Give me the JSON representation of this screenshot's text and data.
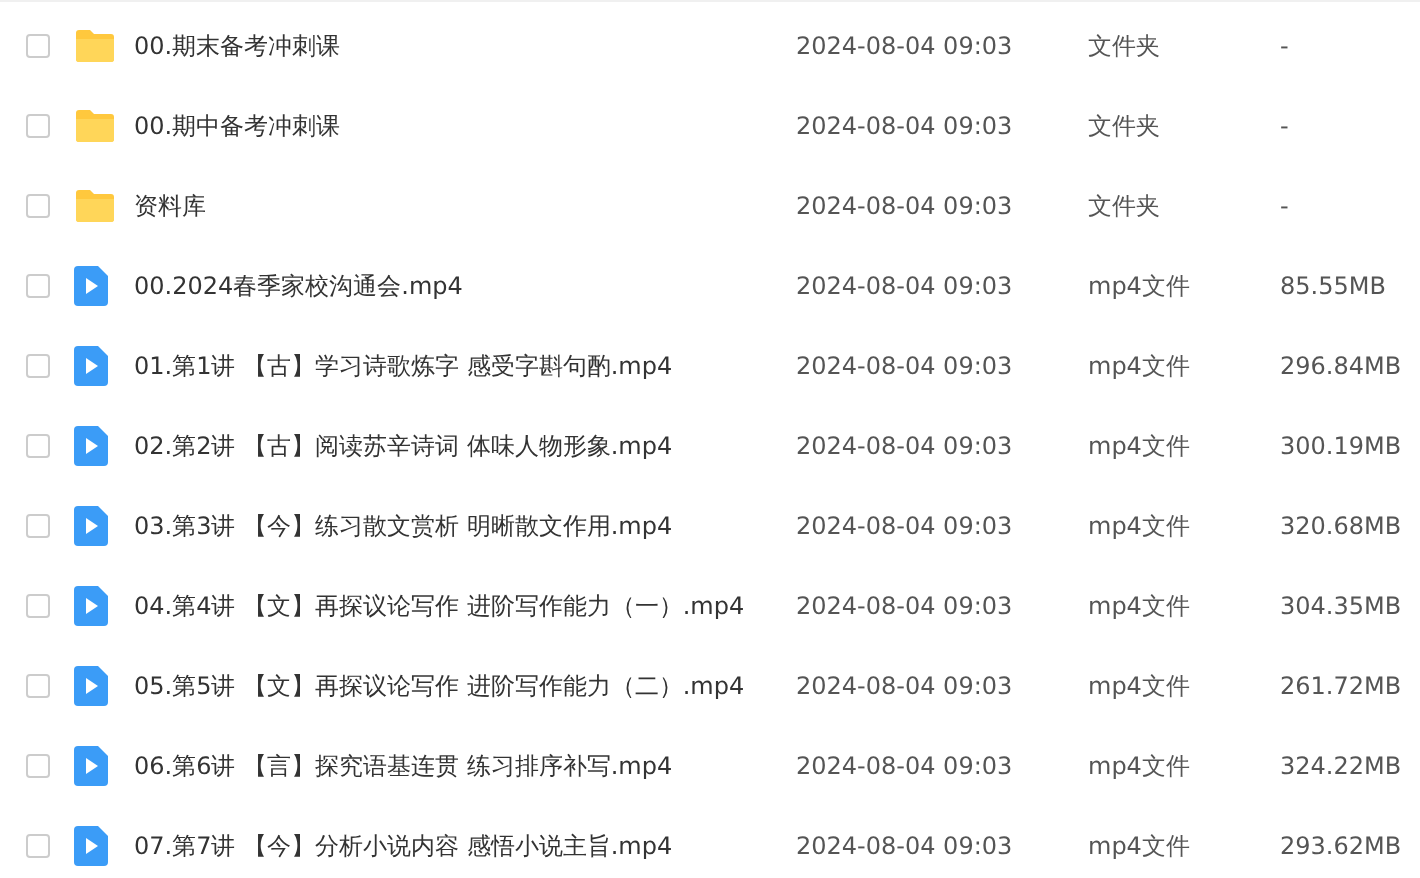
{
  "files": [
    {
      "kind": "folder",
      "checked": false,
      "name": "00.期末备考冲刺课",
      "modified": "2024-08-04 09:03",
      "type": "文件夹",
      "size": "-"
    },
    {
      "kind": "folder",
      "checked": false,
      "name": "00.期中备考冲刺课",
      "modified": "2024-08-04 09:03",
      "type": "文件夹",
      "size": "-"
    },
    {
      "kind": "folder",
      "checked": false,
      "name": "资料库",
      "modified": "2024-08-04 09:03",
      "type": "文件夹",
      "size": "-"
    },
    {
      "kind": "video",
      "checked": false,
      "name": "00.2024春季家校沟通会.mp4",
      "modified": "2024-08-04 09:03",
      "type": "mp4文件",
      "size": "85.55MB"
    },
    {
      "kind": "video",
      "checked": false,
      "name": "01.第1讲 【古】学习诗歌炼字 感受字斟句酌.mp4",
      "modified": "2024-08-04 09:03",
      "type": "mp4文件",
      "size": "296.84MB"
    },
    {
      "kind": "video",
      "checked": false,
      "name": "02.第2讲 【古】阅读苏辛诗词 体味人物形象.mp4",
      "modified": "2024-08-04 09:03",
      "type": "mp4文件",
      "size": "300.19MB"
    },
    {
      "kind": "video",
      "checked": false,
      "name": "03.第3讲 【今】练习散文赏析 明晰散文作用.mp4",
      "modified": "2024-08-04 09:03",
      "type": "mp4文件",
      "size": "320.68MB"
    },
    {
      "kind": "video",
      "checked": false,
      "name": "04.第4讲 【文】再探议论写作 进阶写作能力（一）.mp4",
      "modified": "2024-08-04 09:03",
      "type": "mp4文件",
      "size": "304.35MB"
    },
    {
      "kind": "video",
      "checked": false,
      "name": "05.第5讲 【文】再探议论写作 进阶写作能力（二）.mp4",
      "modified": "2024-08-04 09:03",
      "type": "mp4文件",
      "size": "261.72MB"
    },
    {
      "kind": "video",
      "checked": false,
      "name": "06.第6讲 【言】探究语基连贯 练习排序补写.mp4",
      "modified": "2024-08-04 09:03",
      "type": "mp4文件",
      "size": "324.22MB"
    },
    {
      "kind": "video",
      "checked": false,
      "name": "07.第7讲 【今】分析小说内容 感悟小说主旨.mp4",
      "modified": "2024-08-04 09:03",
      "type": "mp4文件",
      "size": "293.62MB"
    }
  ]
}
